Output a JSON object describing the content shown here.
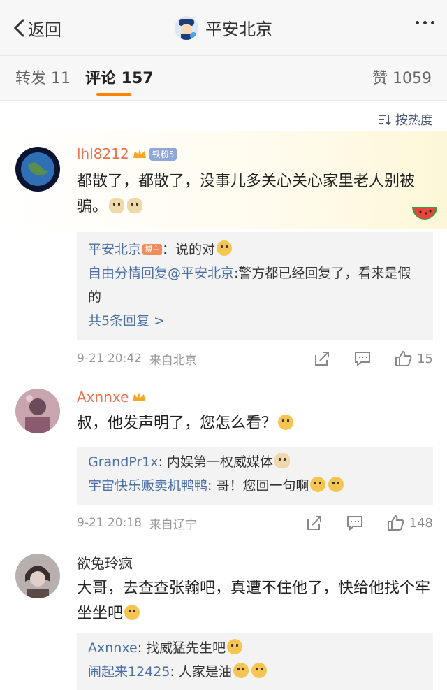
{
  "topbar": {
    "back_label": "返回",
    "title": "平安北京"
  },
  "tabs": {
    "repost": "转发 11",
    "comment": "评论 157",
    "like": "赞 1059"
  },
  "sort_label": "按热度",
  "colors": {
    "accent": "#ff8200",
    "link": "#4a6ea8",
    "username_vip": "#eb7350"
  },
  "comments": [
    {
      "user": "lhl8212",
      "badge": "铁粉5",
      "text": "都散了，都散了，没事儿多关心关心家里老人别被骗。",
      "replies": [
        {
          "name": "平安北京",
          "tag": "博主",
          "text": "：说的对"
        },
        {
          "name": "自由分情回复@平安北京",
          "text": ":警方都已经回复了，看来是假的"
        }
      ],
      "more_replies": "共5条回复 >",
      "time": "9-21 20:42",
      "location": "来自北京",
      "likes": "15"
    },
    {
      "user": "Axnnxe",
      "text": "叔，他发声明了，您怎么看？",
      "replies": [
        {
          "name": "GrandPr1x",
          "text": ": 内娱第一权威媒体"
        },
        {
          "name": "宇宙快乐贩卖机鸭鸭",
          "text": ": 哥！您回一句啊"
        }
      ],
      "time": "9-21 20:18",
      "location": "来自辽宁",
      "likes": "148"
    },
    {
      "user": "欲兔玲疯",
      "text": "大哥，去查查张翰吧，真遭不住他了，快给他找个牢坐坐吧",
      "replies": [
        {
          "name": "Axnnxe",
          "text": ": 找威猛先生吧"
        },
        {
          "name": "闹起来12425",
          "text": ": 人家是油"
        }
      ]
    }
  ],
  "icons": [
    "chevron-left-icon",
    "more-icon",
    "sort-icon",
    "share-icon",
    "comment-icon",
    "like-icon",
    "crown-icon",
    "watermelon-icon"
  ]
}
